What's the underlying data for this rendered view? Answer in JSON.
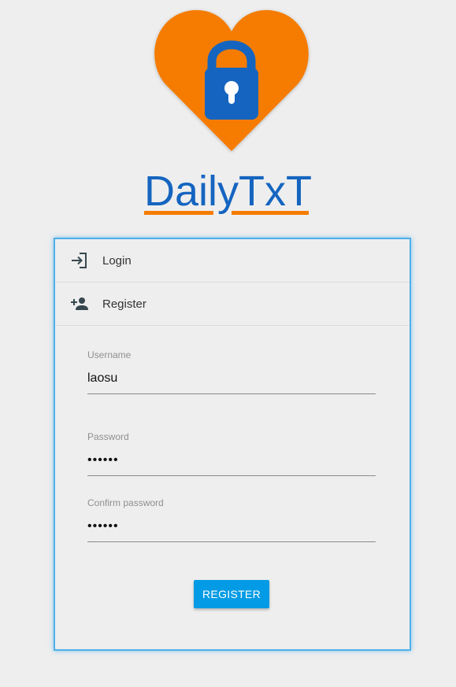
{
  "logo": {
    "icon": "heart-lock-icon",
    "heart_color": "#f57c00",
    "lock_color": "#1565c0"
  },
  "brand": {
    "title": "DailyTxT",
    "text_color": "#1565c0",
    "underline_color": "#f57c00"
  },
  "nav": {
    "items": [
      {
        "label": "Login",
        "icon": "login-icon"
      },
      {
        "label": "Register",
        "icon": "add-user-icon"
      }
    ]
  },
  "form": {
    "username": {
      "label": "Username",
      "value": "laosu"
    },
    "password": {
      "label": "Password",
      "value": "••••••"
    },
    "confirm_password": {
      "label": "Confirm password",
      "value": "••••••"
    },
    "submit_label": "REGISTER",
    "accent_color": "#039be5"
  }
}
